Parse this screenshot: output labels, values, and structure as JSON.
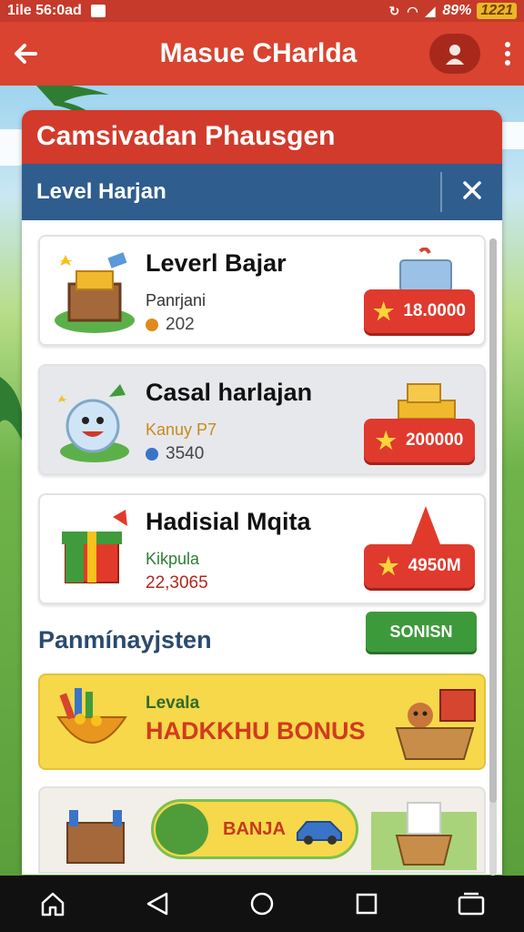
{
  "status_bar": {
    "time": "1ile 56:0ad",
    "battery": "89%",
    "clock_badge": "1221"
  },
  "app_bar": {
    "title": "Masue CHarlda",
    "back_icon": "arrow-left-icon",
    "profile_icon": "person-icon",
    "menu_icon": "more-vert-icon"
  },
  "panel": {
    "title": "Camsivadan Phausgen",
    "subheader": "Level Harjan",
    "close_icon": "close-icon"
  },
  "items": [
    {
      "name": "Leverl Bajar",
      "sub": "Panrjani",
      "value": "202",
      "price": "18.0000",
      "coin_color": "#e08a1a"
    },
    {
      "name": "Casal harlajan",
      "sub": "Kanuy P7",
      "value": "3540",
      "price": "200000",
      "coin_color": "#3a74c9"
    },
    {
      "name": "Hadisial Mqita",
      "sub": "Kikpula",
      "value": "22,3065",
      "price": "4950M",
      "coin_color": ""
    }
  ],
  "section": {
    "title": "Panmínayjsten",
    "button": "SONISN"
  },
  "bonus": {
    "small": "Levala",
    "big": "HADKKHU BONUS"
  },
  "promo": {
    "label": "BANJA"
  },
  "nav": [
    "home-icon",
    "back-triangle-icon",
    "circle-home-icon",
    "square-recents-icon",
    "tabs-icon"
  ],
  "colors": {
    "brand_red": "#d9432f",
    "nav_blue": "#2f5d8e",
    "buy_red": "#e0392d",
    "accent_green": "#3d9a3b",
    "bonus_yellow": "#f6d84a"
  }
}
